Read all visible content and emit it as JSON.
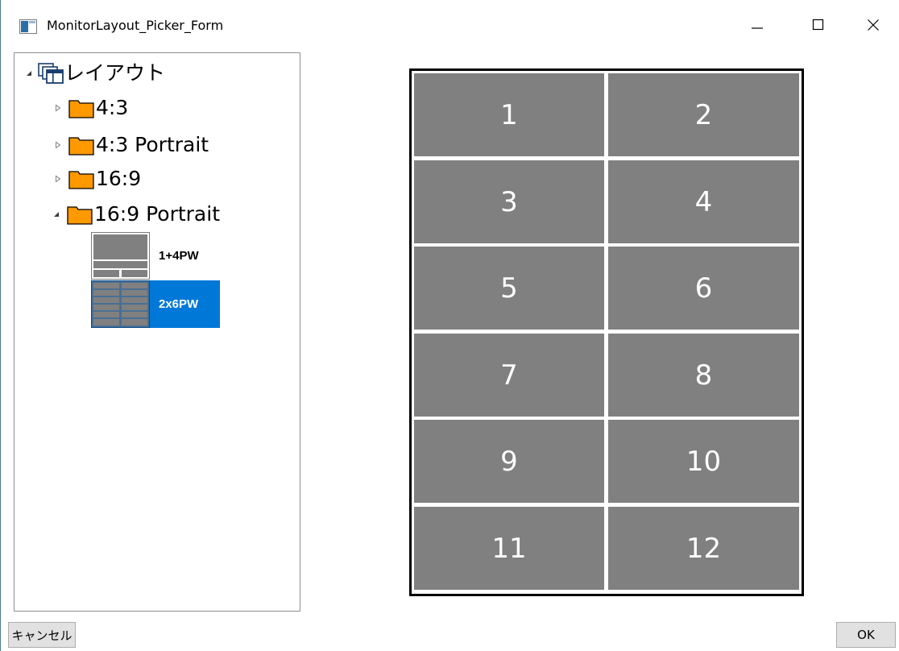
{
  "window": {
    "title": "MonitorLayout_Picker_Form"
  },
  "tree": {
    "root": {
      "label": "レイアウト",
      "icon": "layout-windows-icon"
    },
    "folders": [
      {
        "label": "4:3",
        "expanded": false
      },
      {
        "label": "4:3 Portrait",
        "expanded": false
      },
      {
        "label": "16:9",
        "expanded": false
      },
      {
        "label": "16:9 Portrait",
        "expanded": true
      }
    ],
    "layouts": [
      {
        "label": "1+4PW",
        "selected": false
      },
      {
        "label": "2x6PW",
        "selected": true
      }
    ]
  },
  "preview": {
    "cells": [
      "1",
      "2",
      "3",
      "4",
      "5",
      "6",
      "7",
      "8",
      "9",
      "10",
      "11",
      "12"
    ]
  },
  "buttons": {
    "cancel": "キャンセル",
    "ok": "OK"
  },
  "colors": {
    "selection": "#0078d7",
    "cell": "#808080",
    "folder": "#ff9900"
  }
}
